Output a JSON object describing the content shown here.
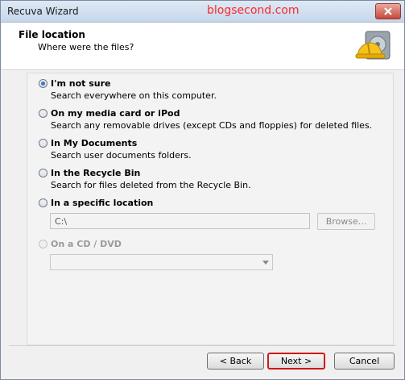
{
  "window": {
    "title": "Recuva Wizard",
    "watermark": "blogsecond.com"
  },
  "header": {
    "title": "File location",
    "subtitle": "Where were the files?"
  },
  "options": [
    {
      "label": "I'm not sure",
      "desc": "Search everywhere on this computer.",
      "checked": true
    },
    {
      "label": "On my media card or iPod",
      "desc": "Search any removable drives (except CDs and floppies) for deleted files."
    },
    {
      "label": "In My Documents",
      "desc": "Search user documents folders."
    },
    {
      "label": "In the Recycle Bin",
      "desc": "Search for files deleted from the Recycle Bin."
    },
    {
      "label": "In a specific location"
    },
    {
      "label": "On a CD / DVD",
      "disabled": true
    }
  ],
  "location": {
    "path": "C:\\",
    "browse_label": "Browse..."
  },
  "buttons": {
    "back": "< Back",
    "next": "Next >",
    "cancel": "Cancel"
  },
  "colors": {
    "watermark": "#ff2a2a",
    "next_highlight": "#d01818"
  },
  "icons": {
    "logo": "recuva-hard-hat-drive-icon",
    "close": "close-icon"
  }
}
